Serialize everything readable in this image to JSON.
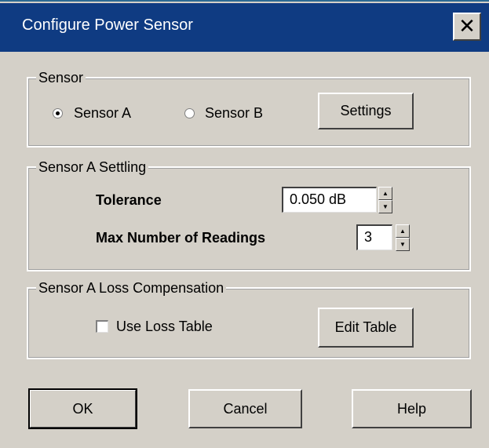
{
  "window": {
    "title": "Configure Power Sensor",
    "close_glyph": "✕"
  },
  "sensor_group": {
    "label": "Sensor",
    "options": [
      {
        "label": "Sensor A",
        "selected": true
      },
      {
        "label": "Sensor B",
        "selected": false
      }
    ],
    "settings_label": "Settings"
  },
  "settling_group": {
    "label": "Sensor A Settling",
    "tolerance_label": "Tolerance",
    "tolerance_value": "0.050 dB",
    "max_readings_label": "Max Number of Readings",
    "max_readings_value": "3"
  },
  "loss_group": {
    "label": "Sensor A Loss Compensation",
    "use_loss_table_label": "Use Loss Table",
    "use_loss_table_checked": false,
    "edit_table_label": "Edit Table"
  },
  "footer": {
    "ok_label": "OK",
    "cancel_label": "Cancel",
    "help_label": "Help"
  },
  "icons": {
    "spin_up": "up-arrow-icon",
    "spin_down": "down-arrow-icon",
    "close": "close-icon"
  },
  "colors": {
    "titlebar": "#0f3b82",
    "dialog_bg": "#d4d0c8"
  }
}
